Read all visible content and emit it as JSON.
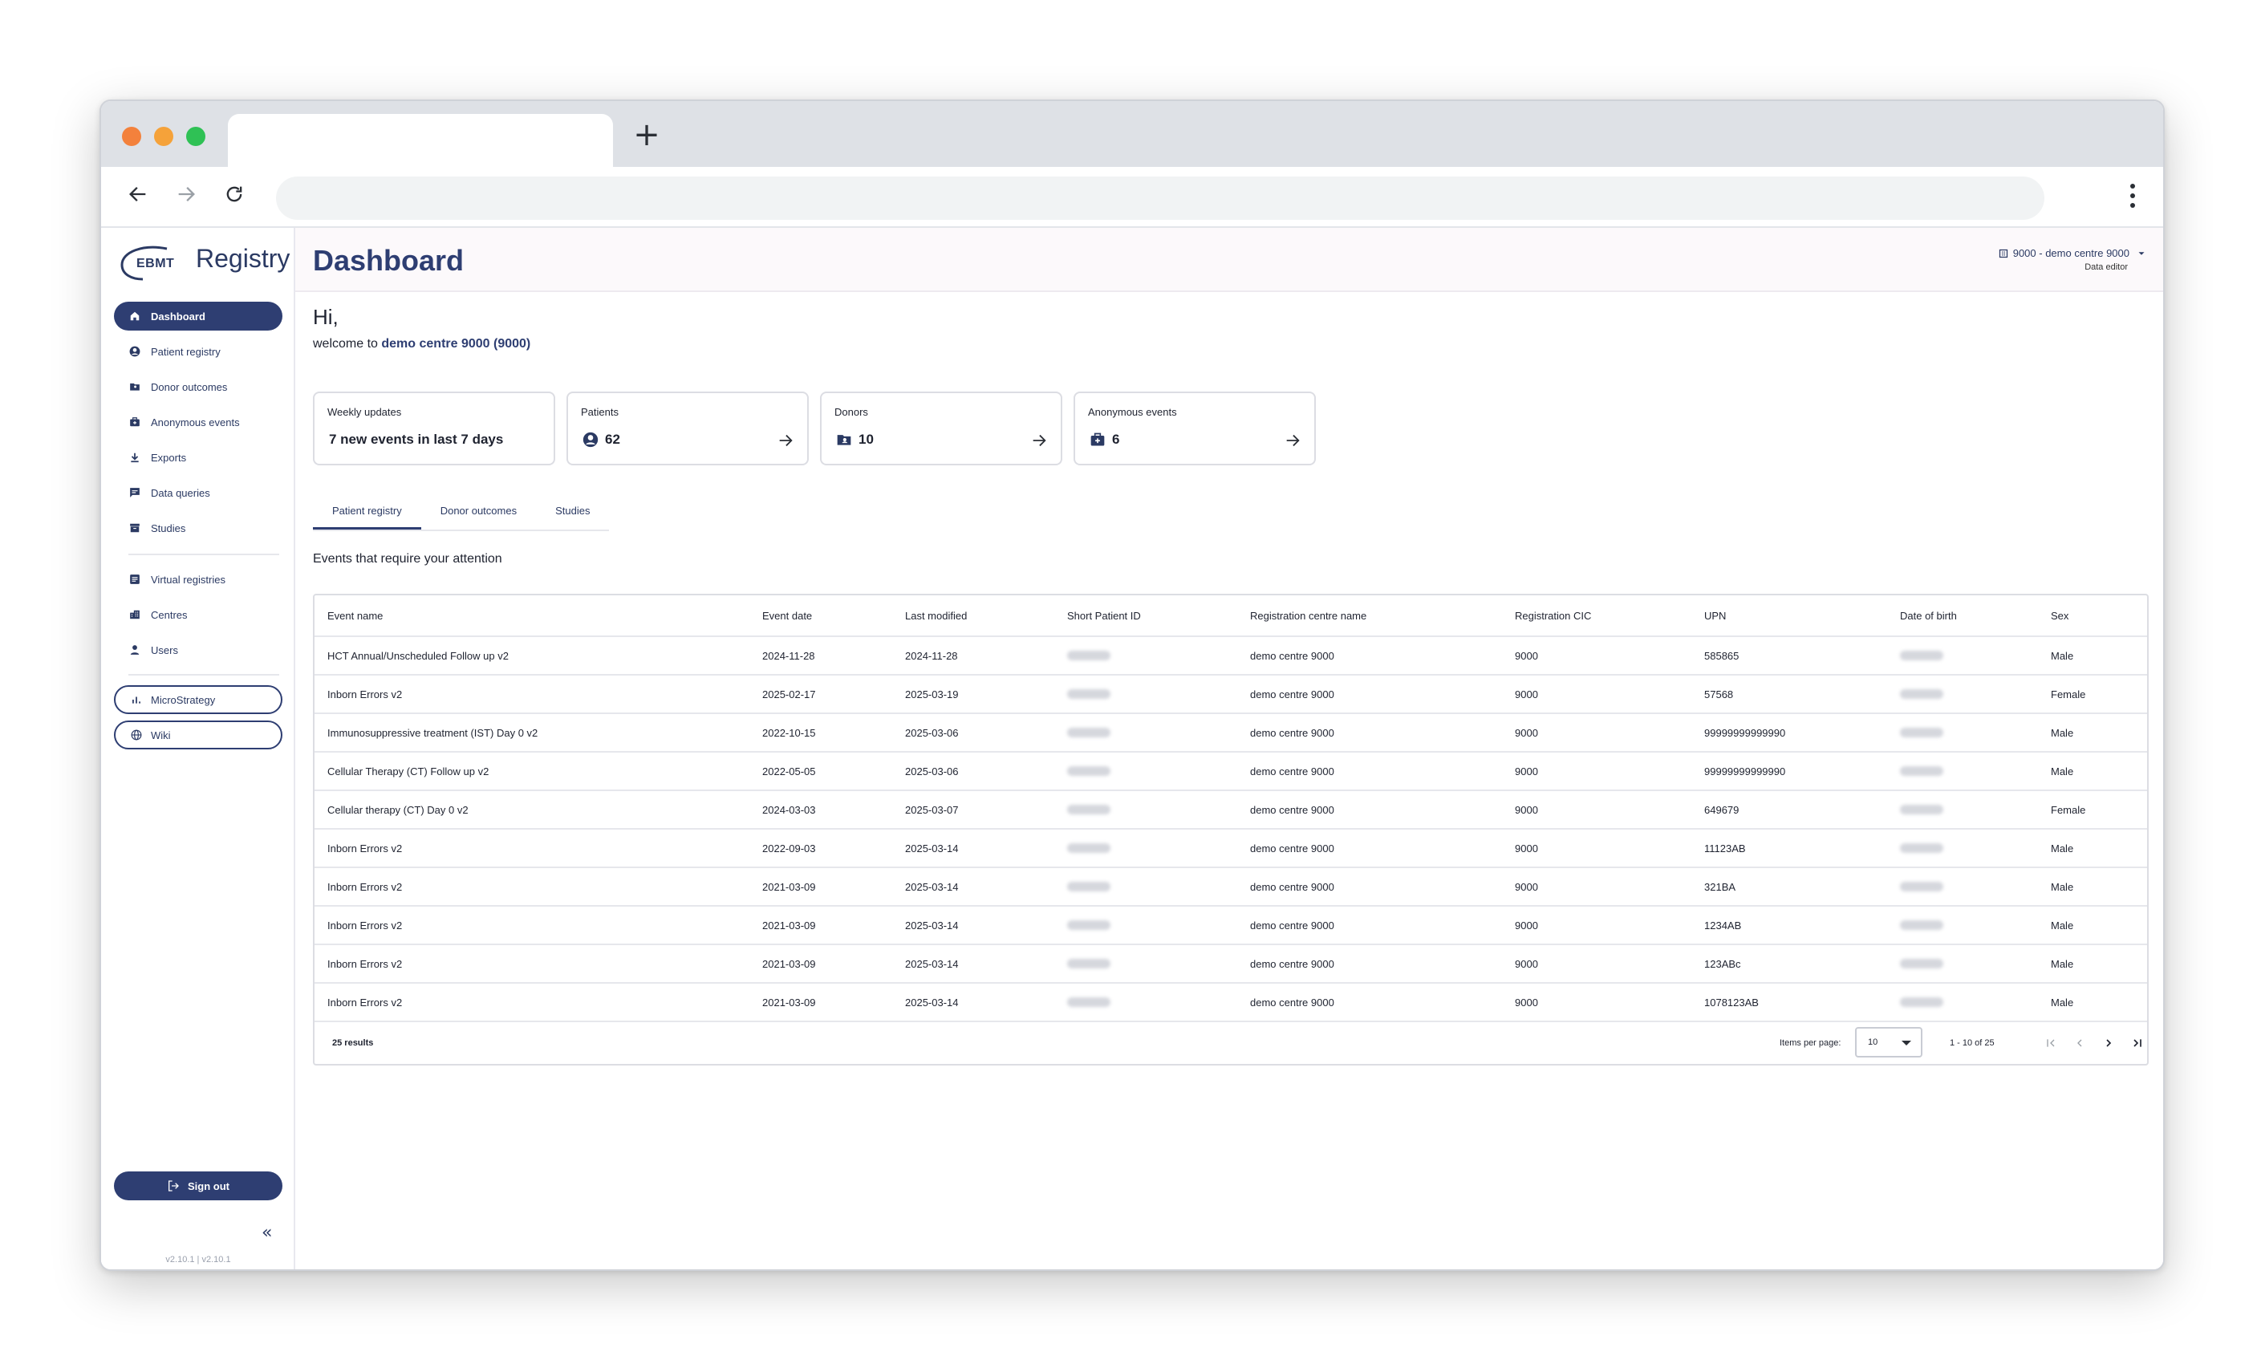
{
  "app": {
    "logo_prefix": "EBMT",
    "logo_name": "Registry",
    "page_title": "Dashboard",
    "version": "v2.10.1 | v2.10.1"
  },
  "centre_selector": {
    "label": "9000 - demo centre 9000",
    "role": "Data editor"
  },
  "sidebar": {
    "items": [
      {
        "label": "Dashboard",
        "icon": "home-icon"
      },
      {
        "label": "Patient registry",
        "icon": "user-circle-icon"
      },
      {
        "label": "Donor outcomes",
        "icon": "folder-user-icon"
      },
      {
        "label": "Anonymous events",
        "icon": "medical-bag-icon"
      },
      {
        "label": "Exports",
        "icon": "download-icon"
      },
      {
        "label": "Data queries",
        "icon": "chat-icon"
      },
      {
        "label": "Studies",
        "icon": "archive-icon"
      }
    ],
    "admin_items": [
      {
        "label": "Virtual registries",
        "icon": "list-box-icon"
      },
      {
        "label": "Centres",
        "icon": "building-icon"
      },
      {
        "label": "Users",
        "icon": "person-icon"
      }
    ],
    "links": [
      {
        "label": "MicroStrategy",
        "icon": "bar-chart-icon"
      },
      {
        "label": "Wiki",
        "icon": "globe-icon"
      }
    ],
    "sign_out": "Sign out"
  },
  "welcome": {
    "greeting": "Hi,",
    "prefix": "welcome to",
    "centre": "demo centre 9000 (9000)"
  },
  "cards": [
    {
      "title": "Weekly updates",
      "value": "7 new events in last 7 days"
    },
    {
      "title": "Patients",
      "value": "62"
    },
    {
      "title": "Donors",
      "value": "10"
    },
    {
      "title": "Anonymous events",
      "value": "6"
    }
  ],
  "tabs": [
    "Patient registry",
    "Donor outcomes",
    "Studies"
  ],
  "section_title": "Events that require your attention",
  "table": {
    "columns": [
      "Event name",
      "Event date",
      "Last modified",
      "Short Patient ID",
      "Registration centre name",
      "Registration CIC",
      "UPN",
      "Date of birth",
      "Sex"
    ],
    "rows": [
      [
        "HCT Annual/Unscheduled Follow up v2",
        "2024-11-28",
        "2024-11-28",
        "demo centre 9000",
        "9000",
        "585865",
        "Male"
      ],
      [
        "Inborn Errors v2",
        "2025-02-17",
        "2025-03-19",
        "demo centre 9000",
        "9000",
        "57568",
        "Female"
      ],
      [
        "Immunosuppressive treatment (IST) Day 0 v2",
        "2022-10-15",
        "2025-03-06",
        "demo centre 9000",
        "9000",
        "99999999999990",
        "Male"
      ],
      [
        "Cellular Therapy (CT) Follow up v2",
        "2022-05-05",
        "2025-03-06",
        "demo centre 9000",
        "9000",
        "99999999999990",
        "Male"
      ],
      [
        "Cellular therapy (CT) Day 0 v2",
        "2024-03-03",
        "2025-03-07",
        "demo centre 9000",
        "9000",
        "649679",
        "Female"
      ],
      [
        "Inborn Errors v2",
        "2022-09-03",
        "2025-03-14",
        "demo centre 9000",
        "9000",
        "11123AB",
        "Male"
      ],
      [
        "Inborn Errors v2",
        "2021-03-09",
        "2025-03-14",
        "demo centre 9000",
        "9000",
        "321BA",
        "Male"
      ],
      [
        "Inborn Errors v2",
        "2021-03-09",
        "2025-03-14",
        "demo centre 9000",
        "9000",
        "1234AB",
        "Male"
      ],
      [
        "Inborn Errors v2",
        "2021-03-09",
        "2025-03-14",
        "demo centre 9000",
        "9000",
        "123ABc",
        "Male"
      ],
      [
        "Inborn Errors v2",
        "2021-03-09",
        "2025-03-14",
        "demo centre 9000",
        "9000",
        "1078123AB",
        "Male"
      ]
    ],
    "results": "25 results",
    "items_per_page_label": "Items per page:",
    "items_per_page": "10",
    "range": "1 - 10 of 25"
  },
  "colors": {
    "primary": "#2e3e72",
    "header_bg": "#fcf9fb",
    "traffic_red": "#f3813c",
    "traffic_yellow": "#f5a23a",
    "traffic_green": "#2fc155"
  }
}
